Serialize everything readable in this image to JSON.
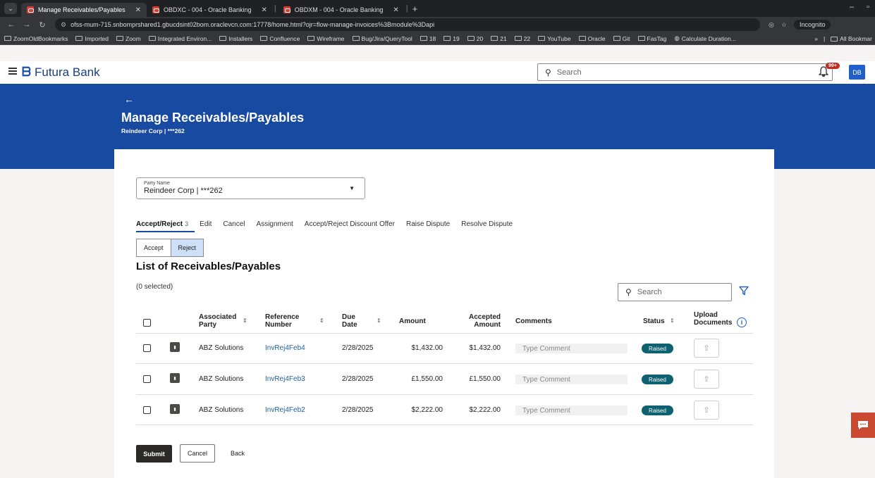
{
  "browser": {
    "tabs": [
      {
        "title": "Manage Receivables/Payables"
      },
      {
        "title": "OBDXC - 004 - Oracle Banking"
      },
      {
        "title": "OBDXM - 004 - Oracle Banking"
      }
    ],
    "url": "ofss-mum-715.snbomprshared1.gbucdsint02bom.oraclevcn.com:17778/home.html?ojr=flow-manage-invoices%3Bmodule%3Dapi",
    "incognito_label": "Incognito",
    "bookmarks": [
      "ZoomOldBookmarks",
      "Imported",
      "Zoom",
      "Integrated Environ...",
      "Installers",
      "Confluence",
      "Wireframe",
      "Bug/Jira/QueryTool",
      "18",
      "19",
      "20",
      "21",
      "22",
      "YouTube",
      "Oracle",
      "Git",
      "FasTag",
      "Calculate Duration..."
    ],
    "bookmarks_right": "All Bookmar"
  },
  "header": {
    "brand": "Futura Bank",
    "search_placeholder": "Search",
    "notification_badge": "99+",
    "avatar": "DB"
  },
  "hero": {
    "title": "Manage Receivables/Payables",
    "subtitle": "Reindeer Corp | ***262"
  },
  "party": {
    "label": "Party Name",
    "value": "Reindeer Corp | ***262"
  },
  "action_tabs": [
    {
      "label": "Accept/Reject",
      "count": "3"
    },
    {
      "label": "Edit"
    },
    {
      "label": "Cancel"
    },
    {
      "label": "Assignment"
    },
    {
      "label": "Accept/Reject Discount Offer"
    },
    {
      "label": "Raise Dispute"
    },
    {
      "label": "Resolve Dispute"
    }
  ],
  "toggle": {
    "accept": "Accept",
    "reject": "Reject"
  },
  "list": {
    "title": "List of Receivables/Payables",
    "selected": "(0 selected)",
    "search_placeholder": "Search",
    "columns": {
      "party_1": "Associated",
      "party_2": "Party",
      "ref_1": "Reference",
      "ref_2": "Number",
      "due_1": "Due",
      "due_2": "Date",
      "amount": "Amount",
      "accepted_1": "Accepted",
      "accepted_2": "Amount",
      "comments": "Comments",
      "status": "Status",
      "upload_1": "Upload",
      "upload_2": "Documents"
    },
    "rows": [
      {
        "party": "ABZ Solutions",
        "ref": "InvRej4Feb4",
        "due": "2/28/2025",
        "amount": "$1,432.00",
        "accepted": "$1,432.00",
        "comment_placeholder": "Type Comment",
        "status": "Raised"
      },
      {
        "party": "ABZ Solutions",
        "ref": "InvRej4Feb3",
        "due": "2/28/2025",
        "amount": "£1,550.00",
        "accepted": "£1,550.00",
        "comment_placeholder": "Type Comment",
        "status": "Raised"
      },
      {
        "party": "ABZ Solutions",
        "ref": "InvRej4Feb2",
        "due": "2/28/2025",
        "amount": "$2,222.00",
        "accepted": "$2,222.00",
        "comment_placeholder": "Type Comment",
        "status": "Raised"
      }
    ]
  },
  "footer": {
    "submit": "Submit",
    "cancel": "Cancel",
    "back": "Back"
  },
  "colors": {
    "brand_blue": "#174aa0",
    "status_teal": "#0d6170",
    "chat_fab": "#c94a30"
  }
}
